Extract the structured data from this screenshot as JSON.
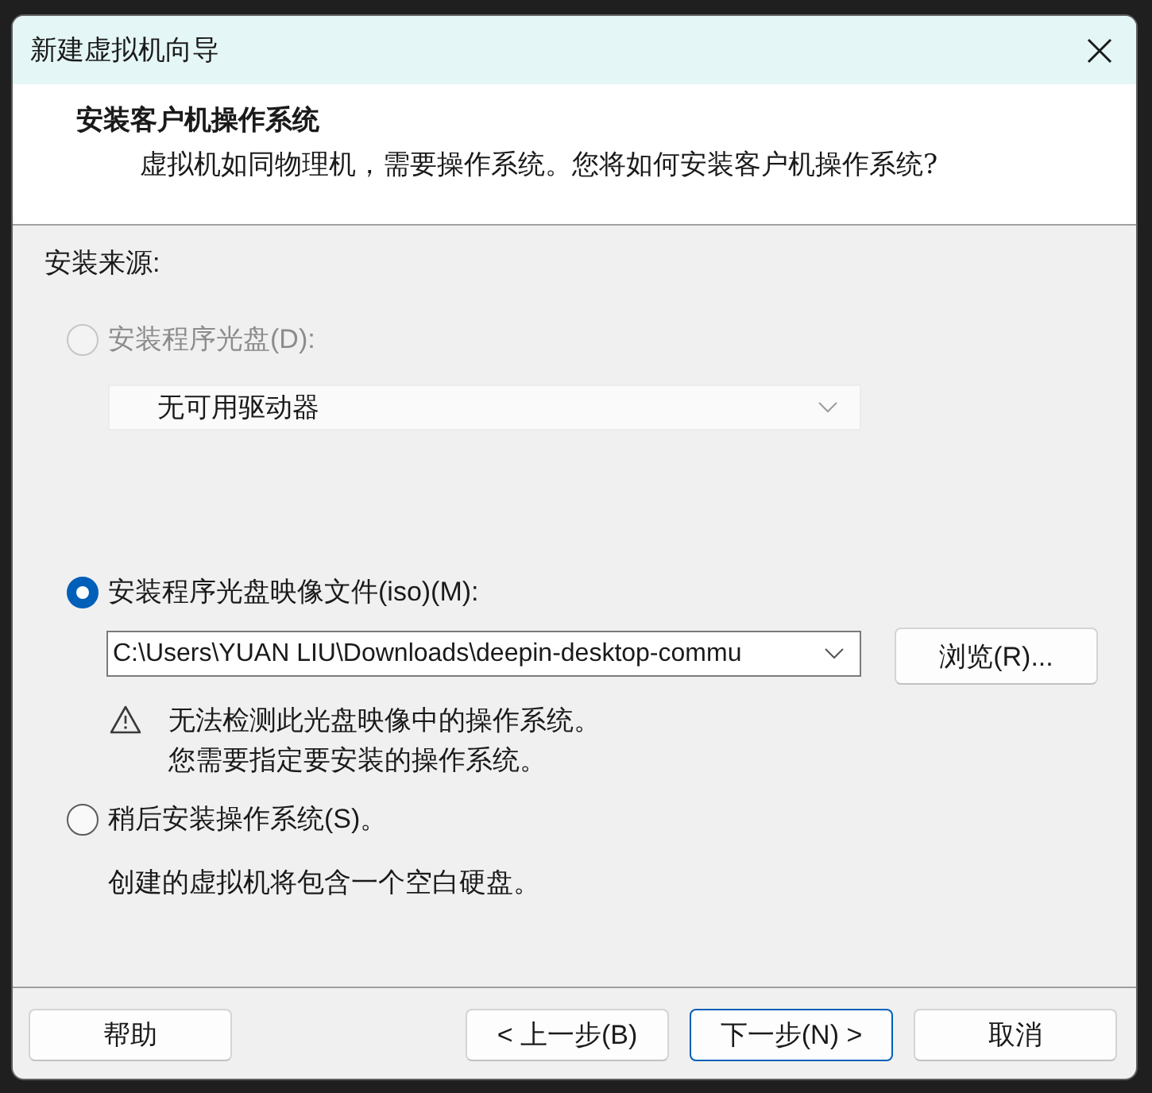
{
  "window": {
    "title": "新建虚拟机向导"
  },
  "header": {
    "title": "安装客户机操作系统",
    "subtitle": "虚拟机如同物理机，需要操作系统。您将如何安装客户机操作系统?"
  },
  "source_label": "安装来源:",
  "options": [
    {
      "label": "安装程序光盘(D):",
      "selected": false,
      "disabled": true,
      "dropdown": {
        "value": "无可用驱动器"
      }
    },
    {
      "label": "安装程序光盘映像文件(iso)(M):",
      "selected": true,
      "disabled": false,
      "path_field": {
        "value": "C:\\Users\\YUAN LIU\\Downloads\\deepin-desktop-commu"
      },
      "browse_button": "浏览(R)...",
      "warning": [
        "无法检测此光盘映像中的操作系统。",
        "您需要指定要安装的操作系统。"
      ]
    },
    {
      "label": "稍后安装操作系统(S)。",
      "selected": false,
      "disabled": false,
      "description": "创建的虚拟机将包含一个空白硬盘。"
    }
  ],
  "buttons": [
    {
      "label": "帮助",
      "default": false
    },
    {
      "label": "< 上一步(B)",
      "default": false
    },
    {
      "label": "下一步(N) >",
      "default": true
    },
    {
      "label": "取消",
      "default": false
    }
  ]
}
